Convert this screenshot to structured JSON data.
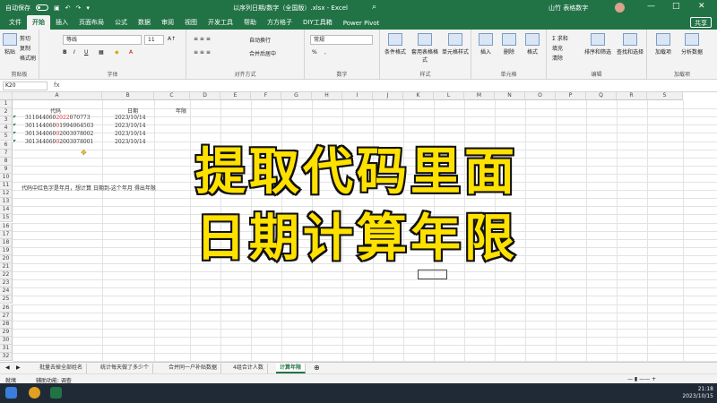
{
  "titlebar": {
    "autosave": "自动保存",
    "file_title": "以序列日期/数字（全国版）.xlsx - Excel",
    "user": "山竹 表格数字",
    "minimize": "—",
    "restore": "□",
    "close": "✕"
  },
  "tabs": [
    "文件",
    "开始",
    "插入",
    "页面布局",
    "公式",
    "数据",
    "审阅",
    "视图",
    "开发工具",
    "帮助",
    "方方格子",
    "DIY工具箱",
    "Power Pivot"
  ],
  "active_tab": "开始",
  "share_label": "共享",
  "ribbon": {
    "clipboard": {
      "paste": "粘贴",
      "cut": "剪切",
      "copy": "复制",
      "format_painter": "格式刷",
      "label": "剪贴板"
    },
    "font": {
      "name": "等线",
      "size": "11",
      "bold": "B",
      "italic": "I",
      "underline": "U",
      "label": "字体"
    },
    "alignment": {
      "wrap": "自动换行",
      "merge": "合并后居中",
      "label": "对齐方式"
    },
    "number": {
      "format": "常规",
      "percent": "%",
      "label": "数字"
    },
    "styles": {
      "cond": "条件格式",
      "table": "套用表格格式",
      "cell": "单元格样式",
      "label": "样式"
    },
    "cells": {
      "insert": "插入",
      "delete": "删除",
      "format": "格式",
      "label": "单元格"
    },
    "editing": {
      "sum": "求和",
      "fill": "填充",
      "clear": "清除",
      "sort": "排序和筛选",
      "find": "查找和选择",
      "label": "编辑"
    },
    "addins": {
      "addins": "加载项",
      "analyze": "分析数据",
      "label": "加载项"
    }
  },
  "formula_bar": {
    "name_box": "K20",
    "fx": "fx",
    "content": ""
  },
  "columns": [
    "A",
    "B",
    "C",
    "D",
    "E",
    "F",
    "G",
    "H",
    "I",
    "J",
    "K",
    "L",
    "M",
    "N",
    "O",
    "P",
    "Q",
    "R",
    "S"
  ],
  "rows": [
    "1",
    "2",
    "3",
    "4",
    "5",
    "6",
    "7",
    "8",
    "9",
    "10",
    "11",
    "12",
    "13",
    "14",
    "15",
    "16",
    "17",
    "18",
    "19",
    "20",
    "21",
    "22",
    "23",
    "24",
    "25",
    "26",
    "27",
    "28",
    "29",
    "30",
    "31",
    "32"
  ],
  "table": {
    "headers": [
      "代码",
      "日期",
      "年限"
    ],
    "rows": [
      {
        "code_black": "311044060",
        "code_red": "2022",
        "code_tail": "070773",
        "date": "2023/10/14"
      },
      {
        "code_black": "301144060",
        "code_red": "0",
        "code_tail": "1994064503",
        "date": "2023/10/14"
      },
      {
        "code_black": "301344060",
        "code_red": "0",
        "code_tail": "2003078002",
        "date": "2023/10/14"
      },
      {
        "code_black": "301344060",
        "code_red": "0",
        "code_tail": "2003078001",
        "date": "2023/10/14"
      }
    ],
    "note": "代码中红色字是年月，想计算  日期到-这个年月      得出年限"
  },
  "overlay": {
    "line1": "提取代码里面",
    "line2": "日期计算年限"
  },
  "sheet_tabs": [
    "批量去掉全部姓名",
    "统计每天做了多少个",
    "合并同一户补贴数据",
    "4组合计人数",
    "计算年限"
  ],
  "active_sheet": "计算年限",
  "status": {
    "ready": "就绪",
    "accessibility": "辅助功能: 调查"
  },
  "taskbar": {
    "time": "21:18",
    "date": "2023/10/15"
  }
}
